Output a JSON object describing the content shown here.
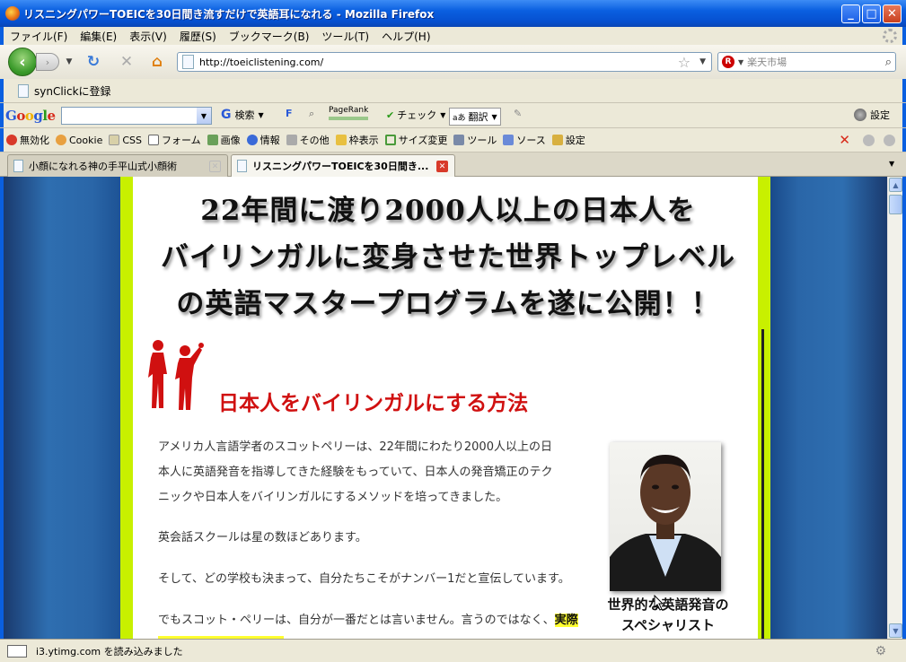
{
  "window": {
    "title": "リスニングパワーTOEICを30日間き流すだけで英語耳になれる - Mozilla Firefox"
  },
  "menu": [
    "ファイル(F)",
    "編集(E)",
    "表示(V)",
    "履歴(S)",
    "ブックマーク(B)",
    "ツール(T)",
    "ヘルプ(H)"
  ],
  "nav": {
    "url": "http://toeiclistening.com/",
    "search_placeholder": "楽天市場"
  },
  "bookmarks": [
    "synClickに登録"
  ],
  "google_toolbar": {
    "logo": "Google",
    "search_label": "検索",
    "pagerank": "PageRank",
    "check": "チェック",
    "translate": "翻訳",
    "settings": "設定"
  },
  "webdev_toolbar": [
    "無効化",
    "Cookie",
    "CSS",
    "フォーム",
    "画像",
    "情報",
    "その他",
    "枠表示",
    "サイズ変更",
    "ツール",
    "ソース",
    "設定"
  ],
  "tabs": [
    {
      "label": "小顔になれる神の手平山式小顔術",
      "active": false
    },
    {
      "label": "リスニングパワーTOEICを30日間き...",
      "active": true
    }
  ],
  "page": {
    "headline": [
      "22年間に渡り2000人以上の日本人を",
      "バイリンガルに変身させた世界トップレベル",
      "の英語マスタープログラムを遂に公開！！"
    ],
    "subhead": "日本人をバイリンガルにする方法",
    "para1": [
      "アメリカ人言語学者のスコットペリーは、22年間にわたり2000人以上の日",
      "本人に英語発音を指導してきた経験をもっていて、日本人の発音矯正のテク",
      "ニックや日本人をバイリンガルにするメソッドを培ってきました。"
    ],
    "para2": "英会話スクールは星の数ほどあります。",
    "para3": "そして、どの学校も決まって、自分たちこそがナンバー1だと宣伝しています。",
    "para4": "でもスコット・ペリーは、自分が一番だとは言いません。言うのではなく、",
    "para4_highlight": "実際",
    "caption": [
      "世界的な英語発音の",
      "スペシャリスト"
    ]
  },
  "status": {
    "text": "i3.ytimg.com を読み込みました"
  },
  "colors": {
    "accent_green": "#c8f000",
    "headline_red": "#d01010",
    "highlight": "#ffff30"
  }
}
